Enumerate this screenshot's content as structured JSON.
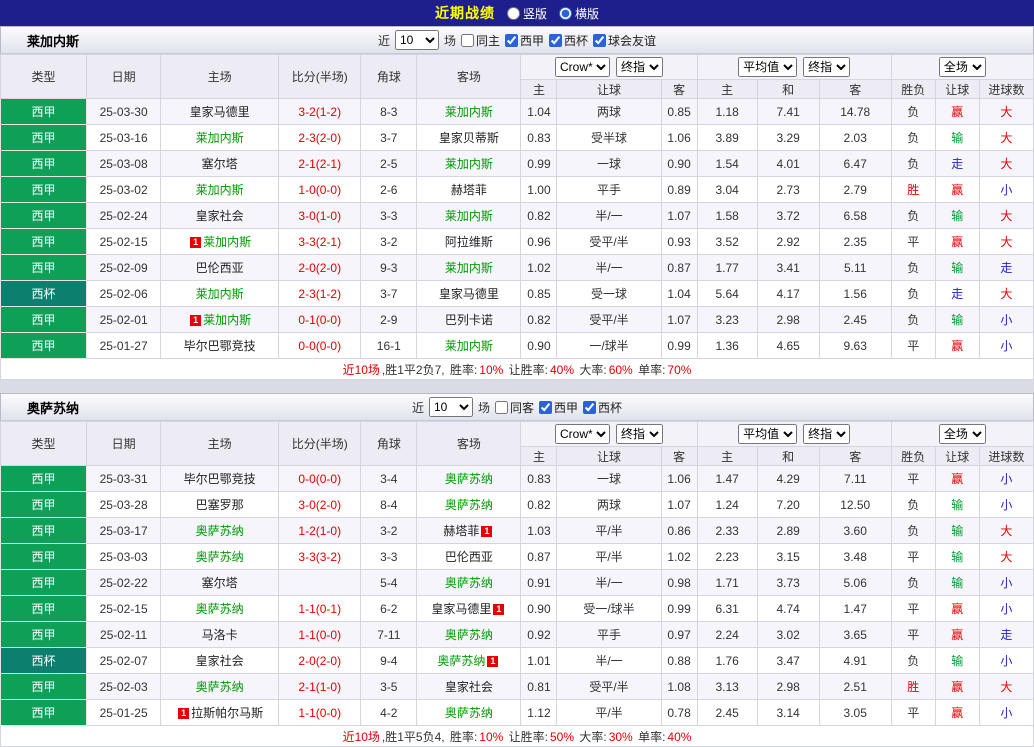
{
  "topbar": {
    "title": "近期战绩",
    "layout_options": [
      {
        "label": "竖版",
        "checked": false
      },
      {
        "label": "横版",
        "checked": true
      }
    ]
  },
  "theme": {
    "topbar_bg": "#1e1e8c",
    "title_color": "#ffff00",
    "liga_bg": "#0fa058",
    "cup_bg": "#0c7f6f",
    "team_green": "#009900",
    "team_black": "#222222",
    "score_red": "#e60000",
    "card_badge_red": "#e60000"
  },
  "result_colors": {
    "胜": "#e60000",
    "平": "#333333",
    "负": "#333333"
  },
  "handicap_colors": {
    "赢": "#e60000",
    "输": "#009933",
    "走": "#2323cc"
  },
  "goal_colors": {
    "大": "#e60000",
    "小": "#2323cc",
    "走": "#2323cc"
  },
  "summary_colors": {
    "r": "#e60000",
    "k": "#333333"
  },
  "tables": [
    {
      "team": "莱加内斯",
      "filter": {
        "prefix": "近",
        "count": "10",
        "suffix": "场",
        "checkboxes": [
          {
            "label": "同主",
            "checked": false
          },
          {
            "label": "西甲",
            "checked": true
          },
          {
            "label": "西杯",
            "checked": true
          },
          {
            "label": "球会友谊",
            "checked": true
          }
        ]
      },
      "selects": [
        "Crow*",
        "终指",
        "平均值",
        "终指",
        "全场"
      ],
      "columns": [
        "类型",
        "日期",
        "主场",
        "比分(半场)",
        "角球",
        "客场",
        "主",
        "让球",
        "客",
        "主",
        "和",
        "客",
        "胜负",
        "让球",
        "进球数"
      ],
      "rows": [
        {
          "league": "西甲",
          "cup": false,
          "date": "25-03-30",
          "home": {
            "name": "皇家马德里",
            "green": false
          },
          "score": "3-2(1-2)",
          "corners": "8-3",
          "away": {
            "name": "莱加内斯",
            "green": true
          },
          "odds": [
            "1.04",
            "两球",
            "0.85"
          ],
          "avg": [
            "1.18",
            "7.41",
            "14.78"
          ],
          "outcome": "负",
          "handicap": "赢",
          "goals": "大"
        },
        {
          "league": "西甲",
          "cup": false,
          "date": "25-03-16",
          "home": {
            "name": "莱加内斯",
            "green": true
          },
          "score": "2-3(2-0)",
          "corners": "3-7",
          "away": {
            "name": "皇家贝蒂斯",
            "green": false
          },
          "odds": [
            "0.83",
            "受半球",
            "1.06"
          ],
          "avg": [
            "3.89",
            "3.29",
            "2.03"
          ],
          "outcome": "负",
          "handicap": "输",
          "goals": "大"
        },
        {
          "league": "西甲",
          "cup": false,
          "date": "25-03-08",
          "home": {
            "name": "塞尔塔",
            "green": false
          },
          "score": "2-1(2-1)",
          "corners": "2-5",
          "away": {
            "name": "莱加内斯",
            "green": true
          },
          "odds": [
            "0.99",
            "一球",
            "0.90"
          ],
          "avg": [
            "1.54",
            "4.01",
            "6.47"
          ],
          "outcome": "负",
          "handicap": "走",
          "goals": "大"
        },
        {
          "league": "西甲",
          "cup": false,
          "date": "25-03-02",
          "home": {
            "name": "莱加内斯",
            "green": true
          },
          "score": "1-0(0-0)",
          "corners": "2-6",
          "away": {
            "name": "赫塔菲",
            "green": false
          },
          "odds": [
            "1.00",
            "平手",
            "0.89"
          ],
          "avg": [
            "3.04",
            "2.73",
            "2.79"
          ],
          "outcome": "胜",
          "handicap": "赢",
          "goals": "小"
        },
        {
          "league": "西甲",
          "cup": false,
          "date": "25-02-24",
          "home": {
            "name": "皇家社会",
            "green": false
          },
          "score": "3-0(1-0)",
          "corners": "3-3",
          "away": {
            "name": "莱加内斯",
            "green": true
          },
          "odds": [
            "0.82",
            "半/一",
            "1.07"
          ],
          "avg": [
            "1.58",
            "3.72",
            "6.58"
          ],
          "outcome": "负",
          "handicap": "输",
          "goals": "大"
        },
        {
          "league": "西甲",
          "cup": false,
          "date": "25-02-15",
          "home": {
            "name": "莱加内斯",
            "green": true,
            "card": "1",
            "card_side": "left"
          },
          "score": "3-3(2-1)",
          "corners": "3-2",
          "away": {
            "name": "阿拉维斯",
            "green": false
          },
          "odds": [
            "0.96",
            "受平/半",
            "0.93"
          ],
          "avg": [
            "3.52",
            "2.92",
            "2.35"
          ],
          "outcome": "平",
          "handicap": "赢",
          "goals": "大"
        },
        {
          "league": "西甲",
          "cup": false,
          "date": "25-02-09",
          "home": {
            "name": "巴伦西亚",
            "green": false
          },
          "score": "2-0(2-0)",
          "corners": "9-3",
          "away": {
            "name": "莱加内斯",
            "green": true
          },
          "odds": [
            "1.02",
            "半/一",
            "0.87"
          ],
          "avg": [
            "1.77",
            "3.41",
            "5.11"
          ],
          "outcome": "负",
          "handicap": "输",
          "goals": "走"
        },
        {
          "league": "西杯",
          "cup": true,
          "date": "25-02-06",
          "home": {
            "name": "莱加内斯",
            "green": true
          },
          "score": "2-3(1-2)",
          "corners": "3-7",
          "away": {
            "name": "皇家马德里",
            "green": false
          },
          "odds": [
            "0.85",
            "受一球",
            "1.04"
          ],
          "avg": [
            "5.64",
            "4.17",
            "1.56"
          ],
          "outcome": "负",
          "handicap": "走",
          "goals": "大"
        },
        {
          "league": "西甲",
          "cup": false,
          "date": "25-02-01",
          "home": {
            "name": "莱加内斯",
            "green": true,
            "card": "1",
            "card_side": "left"
          },
          "score": "0-1(0-0)",
          "corners": "2-9",
          "away": {
            "name": "巴列卡诺",
            "green": false
          },
          "odds": [
            "0.82",
            "受平/半",
            "1.07"
          ],
          "avg": [
            "3.23",
            "2.98",
            "2.45"
          ],
          "outcome": "负",
          "handicap": "输",
          "goals": "小"
        },
        {
          "league": "西甲",
          "cup": false,
          "date": "25-01-27",
          "home": {
            "name": "毕尔巴鄂竞技",
            "green": false
          },
          "score": "0-0(0-0)",
          "corners": "16-1",
          "away": {
            "name": "莱加内斯",
            "green": true
          },
          "odds": [
            "0.90",
            "一/球半",
            "0.99"
          ],
          "avg": [
            "1.36",
            "4.65",
            "9.63"
          ],
          "outcome": "平",
          "handicap": "赢",
          "goals": "小"
        }
      ],
      "summary": [
        {
          "t": "近10场",
          "c": "r"
        },
        {
          "t": ",胜1平2负7, ",
          "c": "k"
        },
        {
          "t": "胜率:",
          "c": "k"
        },
        {
          "t": "10%",
          "c": "r"
        },
        {
          "t": " 让胜率:",
          "c": "k"
        },
        {
          "t": "40%",
          "c": "r"
        },
        {
          "t": " 大率:",
          "c": "k"
        },
        {
          "t": "60%",
          "c": "r"
        },
        {
          "t": " 单率:",
          "c": "k"
        },
        {
          "t": "70%",
          "c": "r"
        }
      ]
    },
    {
      "team": "奥萨苏纳",
      "filter": {
        "prefix": "近",
        "count": "10",
        "suffix": "场",
        "checkboxes": [
          {
            "label": "同客",
            "checked": false
          },
          {
            "label": "西甲",
            "checked": true
          },
          {
            "label": "西杯",
            "checked": true
          }
        ]
      },
      "selects": [
        "Crow*",
        "终指",
        "平均值",
        "终指",
        "全场"
      ],
      "columns": [
        "类型",
        "日期",
        "主场",
        "比分(半场)",
        "角球",
        "客场",
        "主",
        "让球",
        "客",
        "主",
        "和",
        "客",
        "胜负",
        "让球",
        "进球数"
      ],
      "rows": [
        {
          "league": "西甲",
          "cup": false,
          "date": "25-03-31",
          "home": {
            "name": "毕尔巴鄂竞技",
            "green": false
          },
          "score": "0-0(0-0)",
          "corners": "3-4",
          "away": {
            "name": "奥萨苏纳",
            "green": true
          },
          "odds": [
            "0.83",
            "一球",
            "1.06"
          ],
          "avg": [
            "1.47",
            "4.29",
            "7.11"
          ],
          "outcome": "平",
          "handicap": "赢",
          "goals": "小"
        },
        {
          "league": "西甲",
          "cup": false,
          "date": "25-03-28",
          "home": {
            "name": "巴塞罗那",
            "green": false
          },
          "score": "3-0(2-0)",
          "corners": "8-4",
          "away": {
            "name": "奥萨苏纳",
            "green": true
          },
          "odds": [
            "0.82",
            "两球",
            "1.07"
          ],
          "avg": [
            "1.24",
            "7.20",
            "12.50"
          ],
          "outcome": "负",
          "handicap": "输",
          "goals": "小"
        },
        {
          "league": "西甲",
          "cup": false,
          "date": "25-03-17",
          "home": {
            "name": "奥萨苏纳",
            "green": true
          },
          "score": "1-2(1-0)",
          "corners": "3-2",
          "away": {
            "name": "赫塔菲",
            "green": false,
            "card": "1",
            "card_side": "right"
          },
          "odds": [
            "1.03",
            "平/半",
            "0.86"
          ],
          "avg": [
            "2.33",
            "2.89",
            "3.60"
          ],
          "outcome": "负",
          "handicap": "输",
          "goals": "大"
        },
        {
          "league": "西甲",
          "cup": false,
          "date": "25-03-03",
          "home": {
            "name": "奥萨苏纳",
            "green": true
          },
          "score": "3-3(3-2)",
          "corners": "3-3",
          "away": {
            "name": "巴伦西亚",
            "green": false
          },
          "odds": [
            "0.87",
            "平/半",
            "1.02"
          ],
          "avg": [
            "2.23",
            "3.15",
            "3.48"
          ],
          "outcome": "平",
          "handicap": "输",
          "goals": "大"
        },
        {
          "league": "西甲",
          "cup": false,
          "date": "25-02-22",
          "home": {
            "name": "塞尔塔",
            "green": false
          },
          "score": "",
          "corners": "5-4",
          "away": {
            "name": "奥萨苏纳",
            "green": true
          },
          "odds": [
            "0.91",
            "半/一",
            "0.98"
          ],
          "avg": [
            "1.71",
            "3.73",
            "5.06"
          ],
          "outcome": "负",
          "handicap": "输",
          "goals": "小"
        },
        {
          "league": "西甲",
          "cup": false,
          "date": "25-02-15",
          "home": {
            "name": "奥萨苏纳",
            "green": true
          },
          "score": "1-1(0-1)",
          "corners": "6-2",
          "away": {
            "name": "皇家马德里",
            "green": false,
            "card": "1",
            "card_side": "right"
          },
          "odds": [
            "0.90",
            "受一/球半",
            "0.99"
          ],
          "avg": [
            "6.31",
            "4.74",
            "1.47"
          ],
          "outcome": "平",
          "handicap": "赢",
          "goals": "小"
        },
        {
          "league": "西甲",
          "cup": false,
          "date": "25-02-11",
          "home": {
            "name": "马洛卡",
            "green": false
          },
          "score": "1-1(0-0)",
          "corners": "7-11",
          "away": {
            "name": "奥萨苏纳",
            "green": true
          },
          "odds": [
            "0.92",
            "平手",
            "0.97"
          ],
          "avg": [
            "2.24",
            "3.02",
            "3.65"
          ],
          "outcome": "平",
          "handicap": "赢",
          "goals": "走"
        },
        {
          "league": "西杯",
          "cup": true,
          "date": "25-02-07",
          "home": {
            "name": "皇家社会",
            "green": false
          },
          "score": "2-0(2-0)",
          "corners": "9-4",
          "away": {
            "name": "奥萨苏纳",
            "green": true,
            "card": "1",
            "card_side": "right"
          },
          "odds": [
            "1.01",
            "半/一",
            "0.88"
          ],
          "avg": [
            "1.76",
            "3.47",
            "4.91"
          ],
          "outcome": "负",
          "handicap": "输",
          "goals": "小"
        },
        {
          "league": "西甲",
          "cup": false,
          "date": "25-02-03",
          "home": {
            "name": "奥萨苏纳",
            "green": true
          },
          "score": "2-1(1-0)",
          "corners": "3-5",
          "away": {
            "name": "皇家社会",
            "green": false
          },
          "odds": [
            "0.81",
            "受平/半",
            "1.08"
          ],
          "avg": [
            "3.13",
            "2.98",
            "2.51"
          ],
          "outcome": "胜",
          "handicap": "赢",
          "goals": "大"
        },
        {
          "league": "西甲",
          "cup": false,
          "date": "25-01-25",
          "home": {
            "name": "拉斯帕尔马斯",
            "green": false,
            "card": "1",
            "card_side": "left"
          },
          "score": "1-1(0-0)",
          "corners": "4-2",
          "away": {
            "name": "奥萨苏纳",
            "green": true
          },
          "odds": [
            "1.12",
            "平/半",
            "0.78"
          ],
          "avg": [
            "2.45",
            "3.14",
            "3.05"
          ],
          "outcome": "平",
          "handicap": "赢",
          "goals": "小"
        }
      ],
      "summary": [
        {
          "t": "近10场",
          "c": "r"
        },
        {
          "t": ",胜1平5负4, ",
          "c": "k"
        },
        {
          "t": "胜率:",
          "c": "k"
        },
        {
          "t": "10%",
          "c": "r"
        },
        {
          "t": " 让胜率:",
          "c": "k"
        },
        {
          "t": "50%",
          "c": "r"
        },
        {
          "t": " 大率:",
          "c": "k"
        },
        {
          "t": "30%",
          "c": "r"
        },
        {
          "t": " 单率:",
          "c": "k"
        },
        {
          "t": "40%",
          "c": "r"
        }
      ]
    }
  ]
}
